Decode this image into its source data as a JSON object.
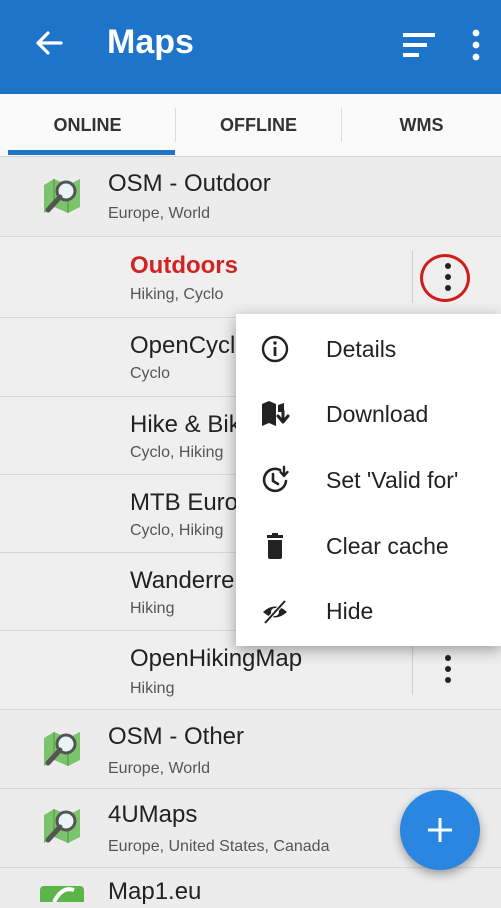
{
  "appbar": {
    "title": "Maps",
    "back_icon": "arrow-back-icon",
    "sort_icon": "sort-icon",
    "more_icon": "more-vert-icon",
    "color": "#1e74c9"
  },
  "tabs": [
    {
      "label": "ONLINE",
      "selected": true
    },
    {
      "label": "OFFLINE",
      "selected": false
    },
    {
      "label": "WMS",
      "selected": false
    }
  ],
  "list": {
    "osm_outdoor": {
      "title": "OSM - Outdoor",
      "subtitle": "Europe, World"
    },
    "outdoors": {
      "title": "Outdoors",
      "subtitle": "Hiking, Cyclo"
    },
    "opencycle": {
      "title": "OpenCycle",
      "subtitle": "Cyclo"
    },
    "hike_bike": {
      "title": "Hike & Bike",
      "subtitle": "Cyclo, Hiking"
    },
    "mtb_europe": {
      "title": "MTB Europ",
      "subtitle": "Cyclo, Hiking"
    },
    "wanderreit": {
      "title": "Wanderreit",
      "subtitle": "Hiking"
    },
    "openhikingmap": {
      "title": "OpenHikingMap",
      "subtitle": "Hiking"
    },
    "osm_other": {
      "title": "OSM - Other",
      "subtitle": "Europe, World"
    },
    "fourumaps": {
      "title": "4UMaps",
      "subtitle": "Europe, United States, Canada"
    },
    "map1eu": {
      "title": "Map1.eu"
    }
  },
  "context_menu": {
    "items": [
      {
        "label": "Details",
        "icon": "info-icon"
      },
      {
        "label": "Download",
        "icon": "download-map-icon"
      },
      {
        "label": "Set 'Valid for'",
        "icon": "valid-for-icon"
      },
      {
        "label": "Clear cache",
        "icon": "trash-icon"
      },
      {
        "label": "Hide",
        "icon": "hide-icon"
      }
    ]
  },
  "fab": {
    "icon": "plus-icon",
    "color": "#2a86e0"
  },
  "colors": {
    "active_item": "#d22323",
    "highlight_ring": "#d11c1c"
  }
}
